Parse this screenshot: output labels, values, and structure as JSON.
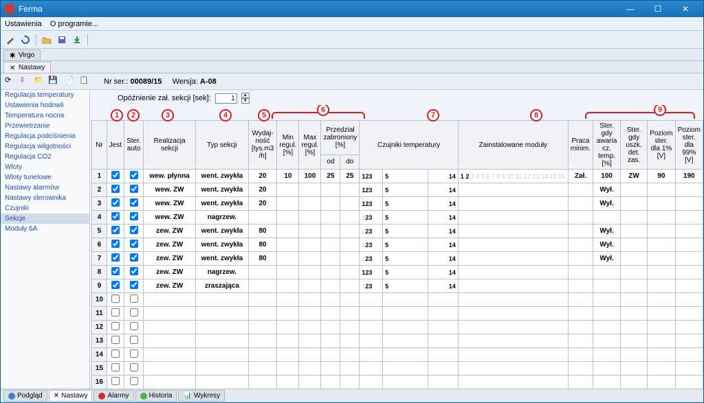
{
  "window": {
    "title": "Ferma"
  },
  "menu": {
    "settings": "Ustawienia",
    "about": "O programie..."
  },
  "top_tabs": {
    "virgo": "Virgo",
    "nastawy": "Nastawy"
  },
  "serial": {
    "label": "Nr ser.:",
    "value": "00089/15",
    "ver_label": "Wersja:",
    "ver_value": "A-08"
  },
  "delay": {
    "label": "Opóźnienie zał. sekcji [sek]:",
    "value": "1"
  },
  "sidebar": {
    "items": [
      "Regulacja temperatury",
      "Ustawienia hodowli",
      "Temperatura nocna",
      "Przewietrzanie",
      "Regulacja podciśnienia",
      "Regulacja wilgotności",
      "Regulacja CO2",
      "Wloty",
      "Wloty tunelowe",
      "Nastawy alarmów",
      "Nastawy sterownika",
      "Czujniki",
      "Sekcje",
      "Moduły 6A"
    ],
    "selected": 12
  },
  "headers": {
    "nr": "Nr",
    "jest": "Jest",
    "ster_auto": "Ster. auto",
    "realizacja": "Realizacja sekcji",
    "typ": "Typ sekcji",
    "wydaj": "Wydaj-\nność\n[tys.m3\n/h]",
    "min": "Min regul. [%]",
    "max": "Max regul. [%]",
    "przedzial": "Przedział zabroniony [%]",
    "od": "od",
    "do": "do",
    "czujniki": "Czujniki temperatury",
    "moduly": "Zainstalowane moduły",
    "praca_min": "Praca minim.",
    "ster_awaria": "Ster. gdy awaria cz. temp. [%]",
    "ster_uszk": "Ster. gdy uszk. det. zas.",
    "poziom1": "Poziom ster. dla 1% [V]",
    "poziom99": "Poziom ster. dla 99% [V]"
  },
  "callout_labels": [
    "1",
    "2",
    "3",
    "4",
    "5",
    "6",
    "7",
    "8",
    "9"
  ],
  "rows": [
    {
      "nr": "1",
      "jest": true,
      "auto": true,
      "real": "wew. płynna",
      "typ": "went. zwykła",
      "wyd": "20",
      "min": "10",
      "max": "100",
      "od": "25",
      "do": "25",
      "sens": "123",
      "s_on": [
        1,
        2,
        3
      ],
      "s_extra": "5",
      "s_right": "14",
      "mod": "1 2",
      "praca": "Zał.",
      "awaria": "100",
      "uszk": "ZW",
      "p1": "90",
      "p99": "190"
    },
    {
      "nr": "2",
      "jest": true,
      "auto": true,
      "real": "wew. ZW",
      "typ": "went. zwykła",
      "wyd": "20",
      "min": "",
      "max": "",
      "od": "",
      "do": "",
      "sens": "123",
      "s_on": [
        1,
        2,
        3
      ],
      "s_extra": "5",
      "s_right": "14",
      "mod": "",
      "praca": "",
      "awaria": "Wył.",
      "uszk": "",
      "p1": "",
      "p99": ""
    },
    {
      "nr": "3",
      "jest": true,
      "auto": true,
      "real": "wew. ZW",
      "typ": "went. zwykła",
      "wyd": "20",
      "min": "",
      "max": "",
      "od": "",
      "do": "",
      "sens": "123",
      "s_on": [
        1,
        2,
        3
      ],
      "s_extra": "5",
      "s_right": "14",
      "mod": "",
      "praca": "",
      "awaria": "Wył.",
      "uszk": "",
      "p1": "",
      "p99": ""
    },
    {
      "nr": "4",
      "jest": true,
      "auto": true,
      "real": "wew. ZW",
      "typ": "nagrzew.",
      "wyd": "",
      "min": "",
      "max": "",
      "od": "",
      "do": "",
      "sens": "23",
      "s_on": [
        2,
        3
      ],
      "s_extra": "5",
      "s_right": "14",
      "mod": "",
      "praca": "",
      "awaria": "",
      "uszk": "",
      "p1": "",
      "p99": ""
    },
    {
      "nr": "5",
      "jest": true,
      "auto": true,
      "real": "zew. ZW",
      "typ": "went. zwykła",
      "wyd": "80",
      "min": "",
      "max": "",
      "od": "",
      "do": "",
      "sens": "23",
      "s_on": [
        2,
        3
      ],
      "s_extra": "5",
      "s_right": "14",
      "mod": "",
      "praca": "",
      "awaria": "Wył.",
      "uszk": "",
      "p1": "",
      "p99": ""
    },
    {
      "nr": "6",
      "jest": true,
      "auto": true,
      "real": "zew. ZW",
      "typ": "went. zwykła",
      "wyd": "80",
      "min": "",
      "max": "",
      "od": "",
      "do": "",
      "sens": "23",
      "s_on": [
        2,
        3
      ],
      "s_extra": "5",
      "s_right": "14",
      "mod": "",
      "praca": "",
      "awaria": "Wył.",
      "uszk": "",
      "p1": "",
      "p99": ""
    },
    {
      "nr": "7",
      "jest": true,
      "auto": true,
      "real": "zew. ZW",
      "typ": "went. zwykła",
      "wyd": "80",
      "min": "",
      "max": "",
      "od": "",
      "do": "",
      "sens": "23",
      "s_on": [
        2,
        3
      ],
      "s_extra": "5",
      "s_right": "14",
      "mod": "",
      "praca": "",
      "awaria": "Wył.",
      "uszk": "",
      "p1": "",
      "p99": ""
    },
    {
      "nr": "8",
      "jest": true,
      "auto": true,
      "real": "zew. ZW",
      "typ": "nagrzew.",
      "wyd": "",
      "min": "",
      "max": "",
      "od": "",
      "do": "",
      "sens": "123",
      "s_on": [
        1,
        2,
        3
      ],
      "s_extra": "5",
      "s_right": "14",
      "mod": "",
      "praca": "",
      "awaria": "",
      "uszk": "",
      "p1": "",
      "p99": ""
    },
    {
      "nr": "9",
      "jest": true,
      "auto": true,
      "real": "zew. ZW",
      "typ": "zraszająca",
      "wyd": "",
      "min": "",
      "max": "",
      "od": "",
      "do": "",
      "sens": "23",
      "s_on": [
        2,
        3
      ],
      "s_extra": "5",
      "s_right": "14",
      "mod": "",
      "praca": "",
      "awaria": "",
      "uszk": "",
      "p1": "",
      "p99": ""
    },
    {
      "nr": "10",
      "jest": false,
      "auto": false,
      "real": "",
      "typ": "",
      "wyd": "",
      "min": "",
      "max": "",
      "od": "",
      "do": "",
      "sens": "",
      "s_on": [],
      "s_extra": "",
      "s_right": "",
      "mod": "",
      "praca": "",
      "awaria": "",
      "uszk": "",
      "p1": "",
      "p99": ""
    },
    {
      "nr": "11",
      "jest": false,
      "auto": false,
      "real": "",
      "typ": "",
      "wyd": "",
      "min": "",
      "max": "",
      "od": "",
      "do": "",
      "sens": "",
      "s_on": [],
      "s_extra": "",
      "s_right": "",
      "mod": "",
      "praca": "",
      "awaria": "",
      "uszk": "",
      "p1": "",
      "p99": ""
    },
    {
      "nr": "12",
      "jest": false,
      "auto": false,
      "real": "",
      "typ": "",
      "wyd": "",
      "min": "",
      "max": "",
      "od": "",
      "do": "",
      "sens": "",
      "s_on": [],
      "s_extra": "",
      "s_right": "",
      "mod": "",
      "praca": "",
      "awaria": "",
      "uszk": "",
      "p1": "",
      "p99": ""
    },
    {
      "nr": "13",
      "jest": false,
      "auto": false,
      "real": "",
      "typ": "",
      "wyd": "",
      "min": "",
      "max": "",
      "od": "",
      "do": "",
      "sens": "",
      "s_on": [],
      "s_extra": "",
      "s_right": "",
      "mod": "",
      "praca": "",
      "awaria": "",
      "uszk": "",
      "p1": "",
      "p99": ""
    },
    {
      "nr": "14",
      "jest": false,
      "auto": false,
      "real": "",
      "typ": "",
      "wyd": "",
      "min": "",
      "max": "",
      "od": "",
      "do": "",
      "sens": "",
      "s_on": [],
      "s_extra": "",
      "s_right": "",
      "mod": "",
      "praca": "",
      "awaria": "",
      "uszk": "",
      "p1": "",
      "p99": ""
    },
    {
      "nr": "15",
      "jest": false,
      "auto": false,
      "real": "",
      "typ": "",
      "wyd": "",
      "min": "",
      "max": "",
      "od": "",
      "do": "",
      "sens": "",
      "s_on": [],
      "s_extra": "",
      "s_right": "",
      "mod": "",
      "praca": "",
      "awaria": "",
      "uszk": "",
      "p1": "",
      "p99": ""
    },
    {
      "nr": "16",
      "jest": false,
      "auto": false,
      "real": "",
      "typ": "",
      "wyd": "",
      "min": "",
      "max": "",
      "od": "",
      "do": "",
      "sens": "",
      "s_on": [],
      "s_extra": "",
      "s_right": "",
      "mod": "",
      "praca": "",
      "awaria": "",
      "uszk": "",
      "p1": "",
      "p99": ""
    }
  ],
  "module_slots": [
    1,
    2,
    3,
    4,
    5,
    6,
    7,
    8,
    9,
    10,
    11,
    12,
    13,
    14,
    15,
    16
  ],
  "bottom_tabs": {
    "podglad": "Podgląd",
    "nastawy": "Nastawy",
    "alarmy": "Alarmy",
    "historia": "Historia",
    "wykresy": "Wykresy"
  }
}
